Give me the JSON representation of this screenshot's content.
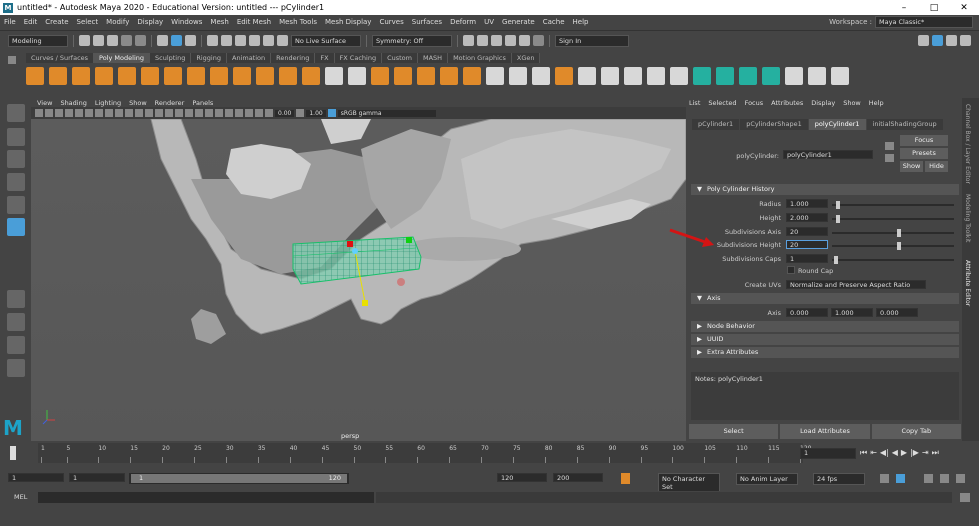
{
  "window": {
    "title": "untitled* - Autodesk Maya 2020 - Educational Version: untitled  ---  pCylinder1",
    "controls": [
      "–",
      "□",
      "✕"
    ]
  },
  "menubar": {
    "items": [
      "File",
      "Edit",
      "Create",
      "Select",
      "Modify",
      "Display",
      "Windows",
      "Mesh",
      "Edit Mesh",
      "Mesh Tools",
      "Mesh Display",
      "Curves",
      "Surfaces",
      "Deform",
      "UV",
      "Generate",
      "Cache",
      "Help"
    ],
    "workspace_label": "Workspace :",
    "workspace_value": "Maya Classic*"
  },
  "statusline": {
    "mode": "Modeling",
    "live_surface": "No Live Surface",
    "symmetry": "Symmetry: Off",
    "sign_in": "Sign In"
  },
  "shelf": {
    "tabs": [
      "Curves / Surfaces",
      "Poly Modeling",
      "Sculpting",
      "Rigging",
      "Animation",
      "Rendering",
      "FX",
      "FX Caching",
      "Custom",
      "MASH",
      "Motion Graphics",
      "XGen"
    ],
    "active_tab": "Poly Modeling"
  },
  "viewport": {
    "menu": [
      "View",
      "Shading",
      "Lighting",
      "Show",
      "Renderer",
      "Panels"
    ],
    "exposure": "0.00",
    "gamma": "1.00",
    "color_space": "sRGB gamma",
    "camera_label": "persp"
  },
  "attribute_editor": {
    "menu": [
      "List",
      "Selected",
      "Focus",
      "Attributes",
      "Display",
      "Show",
      "Help"
    ],
    "tabs": [
      "pCylinder1",
      "pCylinderShape1",
      "polyCylinder1",
      "initialShadingGroup"
    ],
    "active_tab": "polyCylinder1",
    "node_label": "polyCylinder:",
    "node_value": "polyCylinder1",
    "buttons": {
      "focus": "Focus",
      "presets": "Presets",
      "show": "Show",
      "hide": "Hide"
    },
    "history_section": "Poly Cylinder History",
    "fields": [
      {
        "label": "Radius",
        "value": "1.000",
        "slider": 0.03
      },
      {
        "label": "Height",
        "value": "2.000",
        "slider": 0.03
      },
      {
        "label": "Subdivisions Axis",
        "value": "20",
        "slider": 0.55
      },
      {
        "label": "Subdivisions Height",
        "value": "20",
        "slider": 0.55
      },
      {
        "label": "Subdivisions Caps",
        "value": "1",
        "slider": 0.02
      }
    ],
    "round_cap": "Round Cap",
    "create_uvs_label": "Create UVs",
    "create_uvs_value": "Normalize and Preserve Aspect Ratio",
    "axis_section": "Axis",
    "axis_label": "Axis",
    "axis_values": [
      "0.000",
      "1.000",
      "0.000"
    ],
    "collapsed_sections": [
      "Node Behavior",
      "UUID",
      "Extra Attributes"
    ],
    "notes": "Notes:  polyCylinder1",
    "footer": [
      "Select",
      "Load Attributes",
      "Copy Tab"
    ]
  },
  "side_tabs": [
    "Channel Box / Layer Editor",
    "Modeling Toolkit",
    "Attribute Editor"
  ],
  "timeline": {
    "ticks": [
      "1",
      "5",
      "10",
      "15",
      "20",
      "25",
      "30",
      "35",
      "40",
      "45",
      "50",
      "55",
      "60",
      "65",
      "70",
      "75",
      "80",
      "85",
      "90",
      "95",
      "100",
      "105",
      "110",
      "115",
      "120"
    ],
    "current_frame": "1"
  },
  "range": {
    "start": "1",
    "inner_start": "1",
    "slider_start": "1",
    "slider_end": "120",
    "end": "120",
    "outer_end": "200",
    "char_set": "No Character Set",
    "anim_layer": "No Anim Layer",
    "fps": "24 fps"
  },
  "command": {
    "label": "MEL"
  }
}
